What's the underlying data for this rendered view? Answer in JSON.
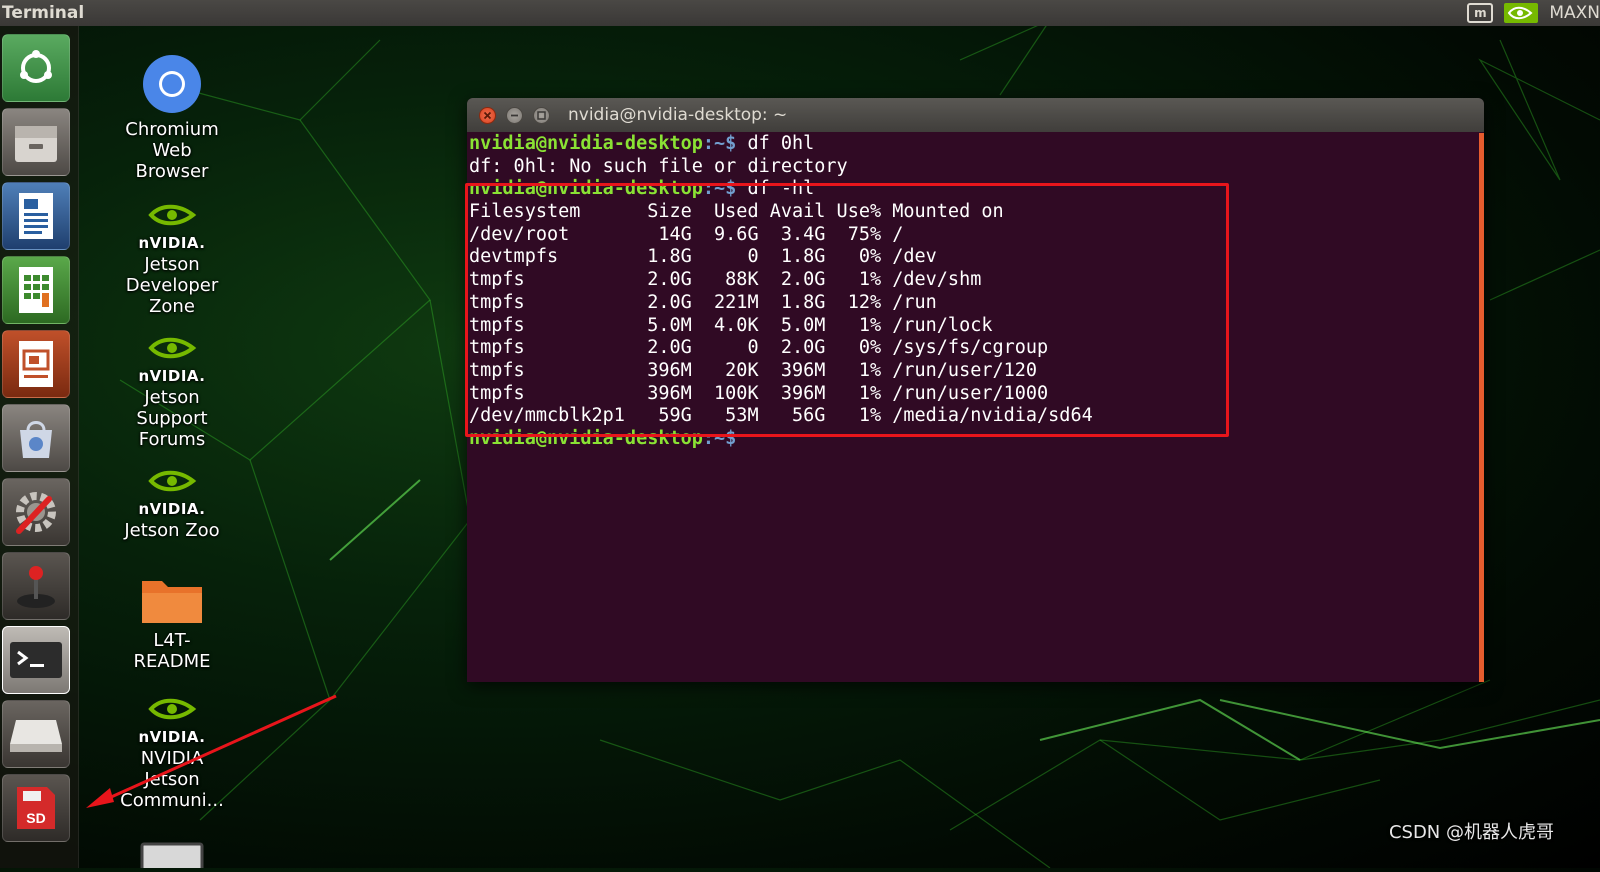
{
  "top_panel": {
    "app_title": "Terminal",
    "keyboard_indicator": "m",
    "power_mode": "MAXN"
  },
  "launcher": {
    "items": [
      {
        "name": "ubuntu-dash-icon"
      },
      {
        "name": "files-icon"
      },
      {
        "name": "writer-icon"
      },
      {
        "name": "calc-icon"
      },
      {
        "name": "impress-icon"
      },
      {
        "name": "software-center-icon"
      },
      {
        "name": "system-settings-icon"
      },
      {
        "name": "joystick-icon"
      },
      {
        "name": "terminal-icon"
      },
      {
        "name": "drive-icon"
      },
      {
        "name": "sd-card-icon",
        "label": "SD"
      }
    ]
  },
  "desktop_icons": [
    {
      "label_lines": [
        "Chromium",
        "Web",
        "Browser"
      ]
    },
    {
      "brand": "nVIDIA.",
      "label_lines": [
        "Jetson",
        "Developer",
        "Zone"
      ]
    },
    {
      "brand": "nVIDIA.",
      "label_lines": [
        "Jetson",
        "Support",
        "Forums"
      ]
    },
    {
      "brand": "nVIDIA.",
      "label_lines": [
        "Jetson Zoo"
      ]
    },
    {
      "label_lines": [
        "L4T-",
        "README"
      ]
    },
    {
      "brand": "nVIDIA.",
      "label_lines": [
        "NVIDIA",
        "Jetson",
        "Communi..."
      ]
    }
  ],
  "terminal": {
    "title": "nvidia@nvidia-desktop: ~",
    "prompt_user": "nvidia@nvidia-desktop",
    "prompt_sep": ":~$",
    "lines": [
      {
        "type": "prompt",
        "cmd": " df 0hl"
      },
      {
        "type": "out",
        "text": "df: 0hl: No such file or directory"
      },
      {
        "type": "prompt",
        "cmd": " df -hl"
      },
      {
        "type": "out",
        "text": "Filesystem      Size  Used Avail Use% Mounted on"
      },
      {
        "type": "out",
        "text": "/dev/root        14G  9.6G  3.4G  75% /"
      },
      {
        "type": "out",
        "text": "devtmpfs        1.8G     0  1.8G   0% /dev"
      },
      {
        "type": "out",
        "text": "tmpfs           2.0G   88K  2.0G   1% /dev/shm"
      },
      {
        "type": "out",
        "text": "tmpfs           2.0G  221M  1.8G  12% /run"
      },
      {
        "type": "out",
        "text": "tmpfs           5.0M  4.0K  5.0M   1% /run/lock"
      },
      {
        "type": "out",
        "text": "tmpfs           2.0G     0  2.0G   0% /sys/fs/cgroup"
      },
      {
        "type": "out",
        "text": "tmpfs           396M   20K  396M   1% /run/user/120"
      },
      {
        "type": "out",
        "text": "tmpfs           396M  100K  396M   1% /run/user/1000"
      },
      {
        "type": "out",
        "text": "/dev/mmcblk2p1   59G   53M   56G   1% /media/nvidia/sd64"
      },
      {
        "type": "prompt",
        "cmd": ""
      }
    ]
  },
  "watermark": "CSDN @机器人虎哥",
  "colors": {
    "terminal_bg": "#300a24",
    "prompt_user": "#8ae234",
    "prompt_path": "#729fcf",
    "highlight": "#e8151b",
    "nvidia_green": "#76b900"
  }
}
